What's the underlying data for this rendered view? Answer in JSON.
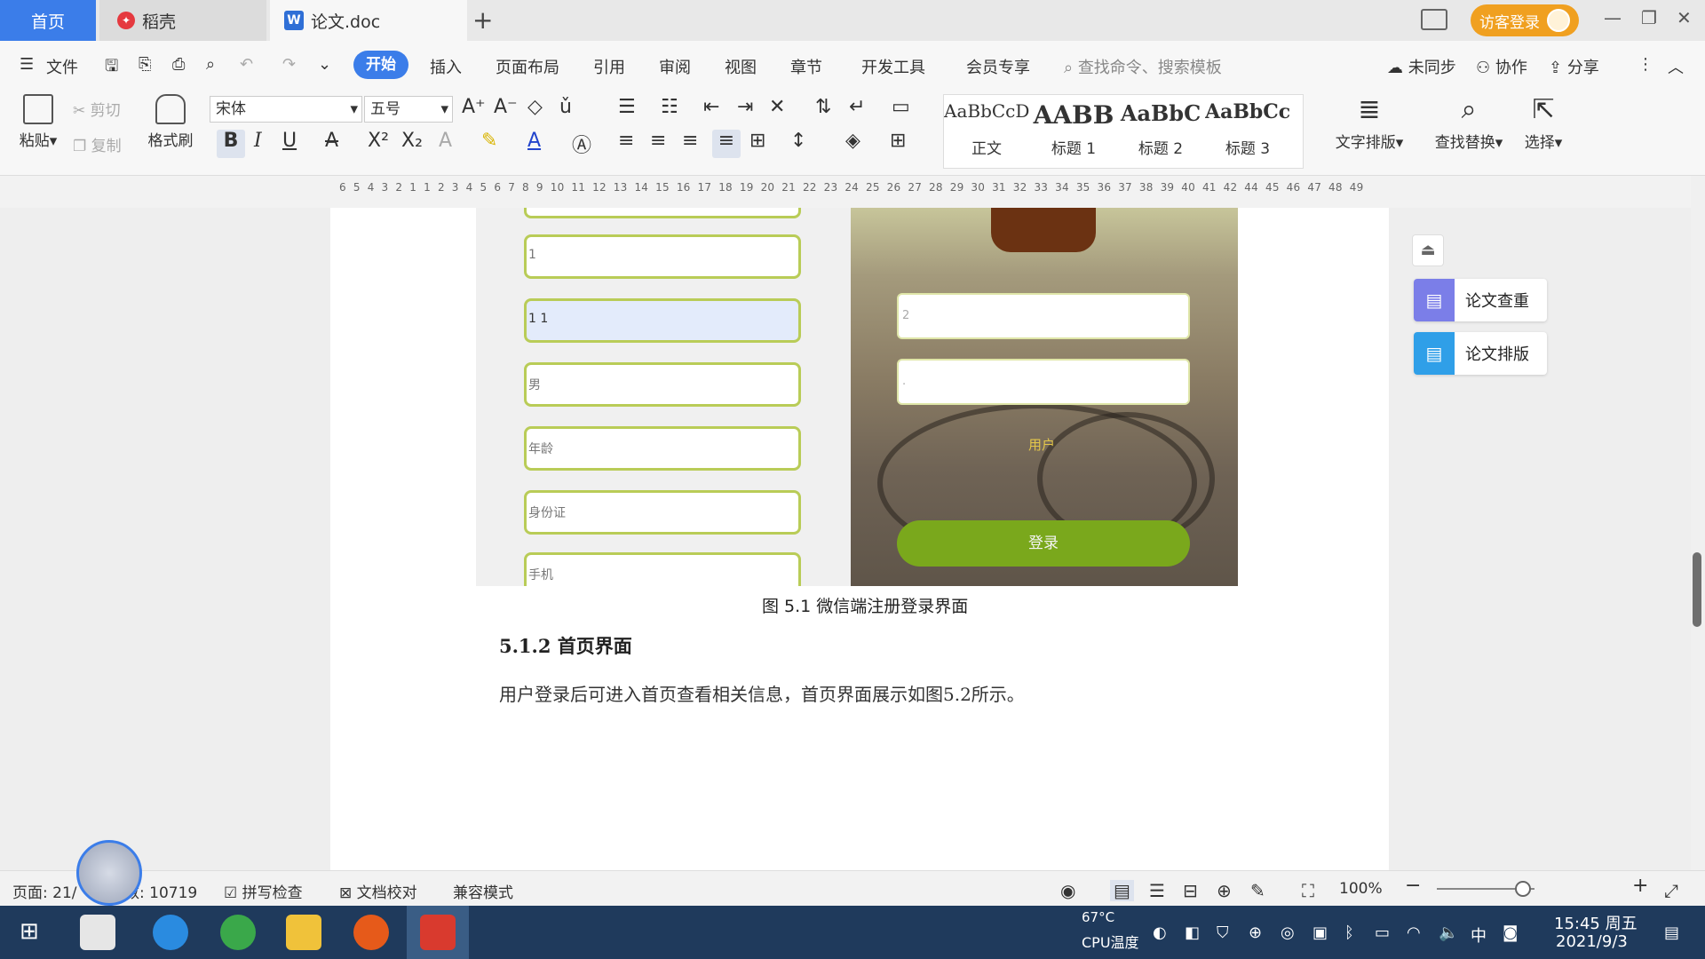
{
  "tabs": {
    "home": "首页",
    "daoke": "稻壳",
    "doc": "论文.doc",
    "add": "+",
    "login": "访客登录"
  },
  "menu": {
    "file": "文件",
    "items": [
      "开始",
      "插入",
      "页面布局",
      "引用",
      "审阅",
      "视图",
      "章节",
      "开发工具",
      "会员专享"
    ],
    "search_placeholder": "查找命令、搜索模板",
    "sync": "未同步",
    "collab": "协作",
    "share": "分享"
  },
  "ribbon": {
    "paste": "粘贴",
    "cut": "剪切",
    "copy": "复制",
    "format_painter": "格式刷",
    "font_name": "宋体",
    "font_size": "五号",
    "styles": [
      {
        "preview": "AaBbCcDd",
        "label": "正文"
      },
      {
        "preview": "AABB",
        "label": "标题 1"
      },
      {
        "preview": "AaBbC",
        "label": "标题 2"
      },
      {
        "preview": "AaBbCcI",
        "label": "标题 3"
      }
    ],
    "text_layout": "文字排版",
    "find_replace": "查找替换",
    "select": "选择"
  },
  "ruler": {
    "numbers": "6 5 4 3 2 1   1 2 3 4 5 6 7 8 9 10 11 12 13 14 15 16 17 18 19 20 21 22 23 24 25 26 27 28 29 30 31 32 33 34 35 36 37 38 39 40 41 42   44 45 46 47 48 49"
  },
  "form_image": {
    "fields": [
      "1",
      "1 1",
      "男",
      "年龄",
      "身份证",
      "手机"
    ]
  },
  "login_image": {
    "field1": "2",
    "field2": ".",
    "heart_text": "用户",
    "login_button": "登录"
  },
  "document": {
    "caption": "图 5.1  微信端注册登录界面",
    "heading": "5.1.2 首页界面",
    "body": "用户登录后可进入首页查看相关信息，首页界面展示如图5.2所示。"
  },
  "side_panel": {
    "check": "论文查重",
    "format": "论文排版"
  },
  "status": {
    "page": "页面: 21/",
    "wordcount": "数: 10719",
    "spellcheck": "拼写检查",
    "proofread": "文档校对",
    "compat": "兼容模式",
    "zoom": "100%"
  },
  "taskbar": {
    "temp": "67°C",
    "temp_label": "CPU温度",
    "ime": "中",
    "time": "15:45 周五",
    "date": "2021/9/3"
  },
  "colors": {
    "accent": "#3b7de9",
    "login_orange": "#f0a020",
    "field_border": "#b9cc57",
    "login_green": "#7aa81c"
  }
}
